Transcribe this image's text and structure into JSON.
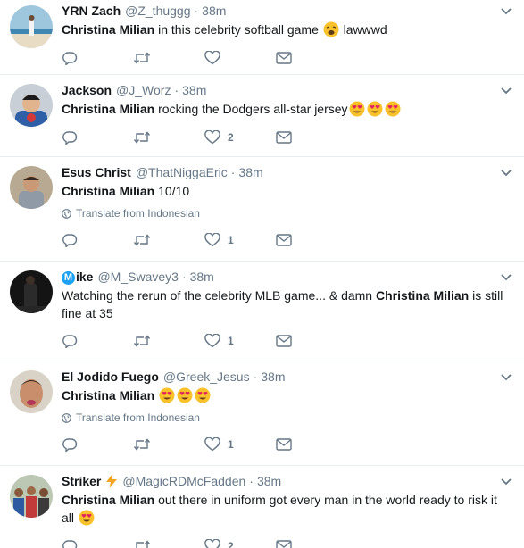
{
  "tweets": [
    {
      "fullname": "YRN Zach",
      "username": "@Z_thuggg",
      "dot": "·",
      "time": "38m",
      "text_bold": "Christina Milian",
      "text_rest": " in this celebrity softball game ",
      "text_tail": " lawwwd",
      "emoji": "weary-face",
      "translate": "",
      "like_count": ""
    },
    {
      "fullname": "Jackson",
      "username": "@J_Worz",
      "dot": "·",
      "time": "38m",
      "text_bold": "Christina Milian",
      "text_rest": " rocking the Dodgers all-star jersey",
      "emoji": "heart-eyes-x3",
      "translate": "",
      "like_count": "2"
    },
    {
      "fullname": "Esus Christ",
      "username": "@ThatNiggaEric",
      "dot": "·",
      "time": "38m",
      "text_bold": "Christina Milian",
      "text_rest": " 10/10",
      "translate": "Translate from Indonesian",
      "like_count": "1"
    },
    {
      "fullname_initial": "M",
      "fullname": "ike",
      "username": "@M_Swavey3",
      "dot": "·",
      "time": "38m",
      "text_pre": "Watching the rerun of the celebrity MLB game... & damn ",
      "text_bold": "Christina Milian",
      "text_rest": " is still fine at 35",
      "translate": "",
      "like_count": "1"
    },
    {
      "fullname": "El Jodido Fuego",
      "username": "@Greek_Jesus",
      "dot": "·",
      "time": "38m",
      "text_bold": "Christina Milian",
      "emoji": "heart-eyes-x3",
      "translate": "Translate from Indonesian",
      "like_count": "1"
    },
    {
      "fullname": "Striker",
      "username": "@MagicRDMcFadden",
      "dot": "·",
      "time": "38m",
      "text_bold": "Christina Milian",
      "text_rest": " out there in uniform got every man in the world ready to risk it all",
      "emoji": "heart-eyes",
      "translate": "",
      "like_count": "2"
    }
  ],
  "icons": {
    "reply": "reply-icon",
    "retweet": "retweet-icon",
    "like": "heart-icon",
    "dm": "envelope-icon",
    "caret": "chevron-down-icon",
    "globe": "globe-icon",
    "bolt": "lightning-icon"
  },
  "colors": {
    "text": "#14171a",
    "secondary": "#657786",
    "divider": "#e6ecf0",
    "link": "#1da1f2"
  }
}
